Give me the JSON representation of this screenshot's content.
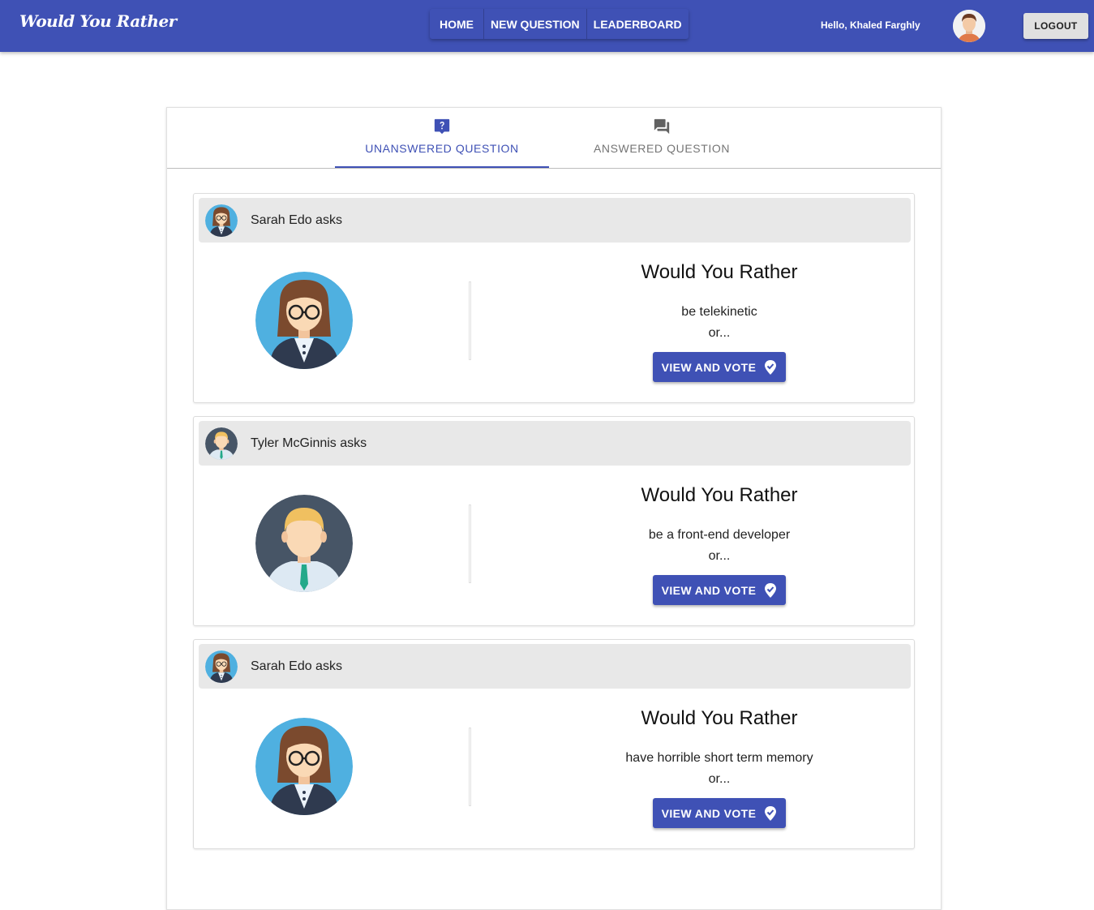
{
  "app": {
    "brand": "Would You Rather",
    "nav": [
      {
        "label": "HOME"
      },
      {
        "label": "NEW QUESTION"
      },
      {
        "label": "LEADERBOARD"
      }
    ],
    "greeting": "Hello, Khaled Farghly",
    "logout_label": "LOGOUT",
    "accent_color": "#3f51b5"
  },
  "tabs": [
    {
      "label": "UNANSWERED QUESTION",
      "icon": "question-bubble-icon",
      "active": true
    },
    {
      "label": "ANSWERED QUESTION",
      "icon": "forum-icon",
      "active": false
    }
  ],
  "questions": [
    {
      "asker": "Sarah Edo asks",
      "avatar": "woman-glasses-avatar",
      "title": "Would You Rather",
      "option": "be telekinetic",
      "or": "or...",
      "button": "VIEW AND VOTE"
    },
    {
      "asker": "Tyler McGinnis asks",
      "avatar": "man-blond-avatar",
      "title": "Would You Rather",
      "option": "be a front-end developer",
      "or": "or...",
      "button": "VIEW AND VOTE"
    },
    {
      "asker": "Sarah Edo asks",
      "avatar": "woman-glasses-avatar",
      "title": "Would You Rather",
      "option": "have horrible short term memory",
      "or": "or...",
      "button": "VIEW AND VOTE"
    }
  ]
}
